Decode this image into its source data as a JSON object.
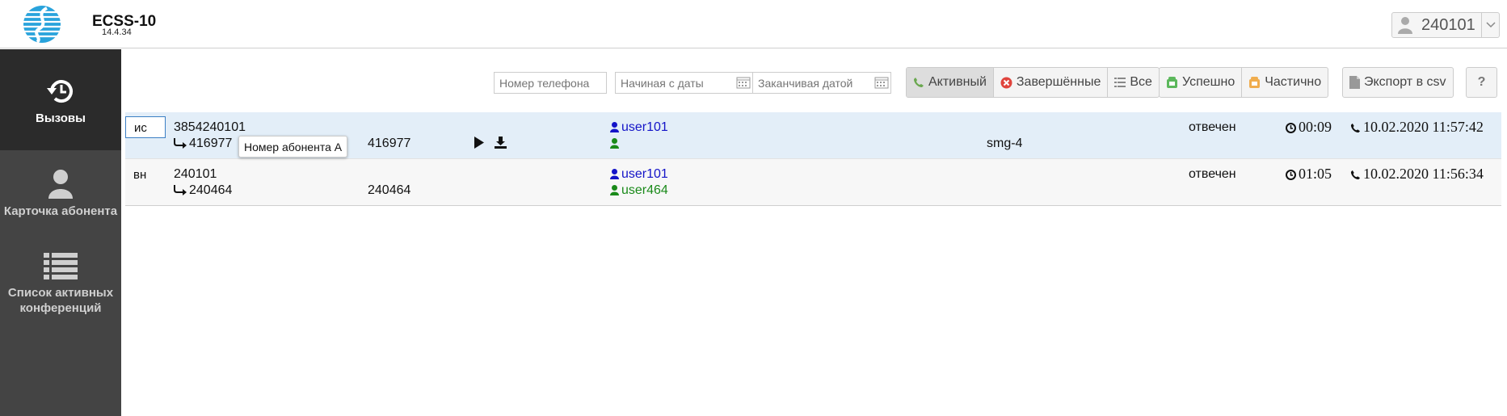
{
  "header": {
    "app_title": "ECSS-10",
    "app_version": "14.4.34",
    "user": "240101"
  },
  "sidebar": {
    "items": [
      {
        "label": "Вызовы",
        "icon": "history-icon",
        "active": true
      },
      {
        "label": "Карточка абонента",
        "icon": "user-icon",
        "active": false
      },
      {
        "label": "Список активных конференций",
        "icon": "list-icon",
        "active": false
      }
    ]
  },
  "toolbar": {
    "phone_placeholder": "Номер телефона",
    "from_placeholder": "Начиная с даты",
    "to_placeholder": "Заканчивая датой",
    "filters": {
      "active": "Активный",
      "finished": "Завершённые",
      "all": "Все"
    },
    "results": {
      "success": "Успешно",
      "partial": "Частично"
    },
    "export": "Экспорт в csv",
    "help": "?"
  },
  "calls": [
    {
      "direction": "ис",
      "number_a": "3854240101",
      "redirect_a": "416977",
      "number_b": "416977",
      "user_a": "user101",
      "user_b": "",
      "gateway": "smg-4",
      "status": "отвечен",
      "duration": "00:09",
      "datetime": "10.02.2020 11:57:42"
    },
    {
      "direction": "вн",
      "number_a": "240101",
      "redirect_a": "240464",
      "number_b": "240464",
      "user_a": "user101",
      "user_b": "user464",
      "gateway": "",
      "status": "отвечен",
      "duration": "01:05",
      "datetime": "10.02.2020 11:56:34"
    }
  ],
  "tooltip": "Номер абонента А",
  "colors": {
    "sidebar": "#444444",
    "sidebar_active": "#2b2b2b",
    "selected_row": "#e3eef8",
    "user_a": "#1414c8",
    "user_b": "#1a8a1a"
  }
}
